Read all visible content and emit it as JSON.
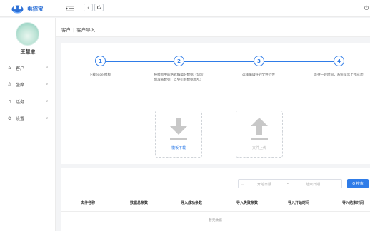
{
  "app": {
    "brand": "电招宝"
  },
  "topbar": {
    "menu_icon": "menu-fold-icon",
    "back_icon": "chevron-left-icon",
    "refresh_icon": "refresh-icon",
    "power_icon": "power-icon"
  },
  "sidebar": {
    "avatar_text": "",
    "username": "王慧忠",
    "items": [
      {
        "label": "客户",
        "icon": "home-icon"
      },
      {
        "label": "坐席",
        "icon": "user-icon"
      },
      {
        "label": "话务",
        "icon": "headset-icon"
      },
      {
        "label": "设置",
        "icon": "gear-icon"
      }
    ]
  },
  "breadcrumb": {
    "root": "客户",
    "sep": "|",
    "current": "客户导入"
  },
  "steps": [
    {
      "num": "1",
      "text": "下载excel模板"
    },
    {
      "num": "2",
      "text": "按模板中的格式编辑好数据（切勿增减表数列，以免引起数据混乱）"
    },
    {
      "num": "3",
      "text": "选择编辑好的文件上传"
    },
    {
      "num": "4",
      "text": "等待一段时间，系统提示上传成功"
    }
  ],
  "actions": {
    "download_label": "模板下载",
    "upload_label": "文件上传"
  },
  "filter": {
    "start_placeholder": "开始日期",
    "dash": "-",
    "end_placeholder": "结束日期",
    "search_label": "Q 搜索"
  },
  "table": {
    "headers": [
      "文件名称",
      "数据总条数",
      "导入成功条数",
      "导入失败条数",
      "导入开始时间",
      "导入结束时间"
    ],
    "empty_text": "暂无数据"
  },
  "colors": {
    "accent": "#2f7ce8",
    "brand": "#2b6fd6"
  }
}
